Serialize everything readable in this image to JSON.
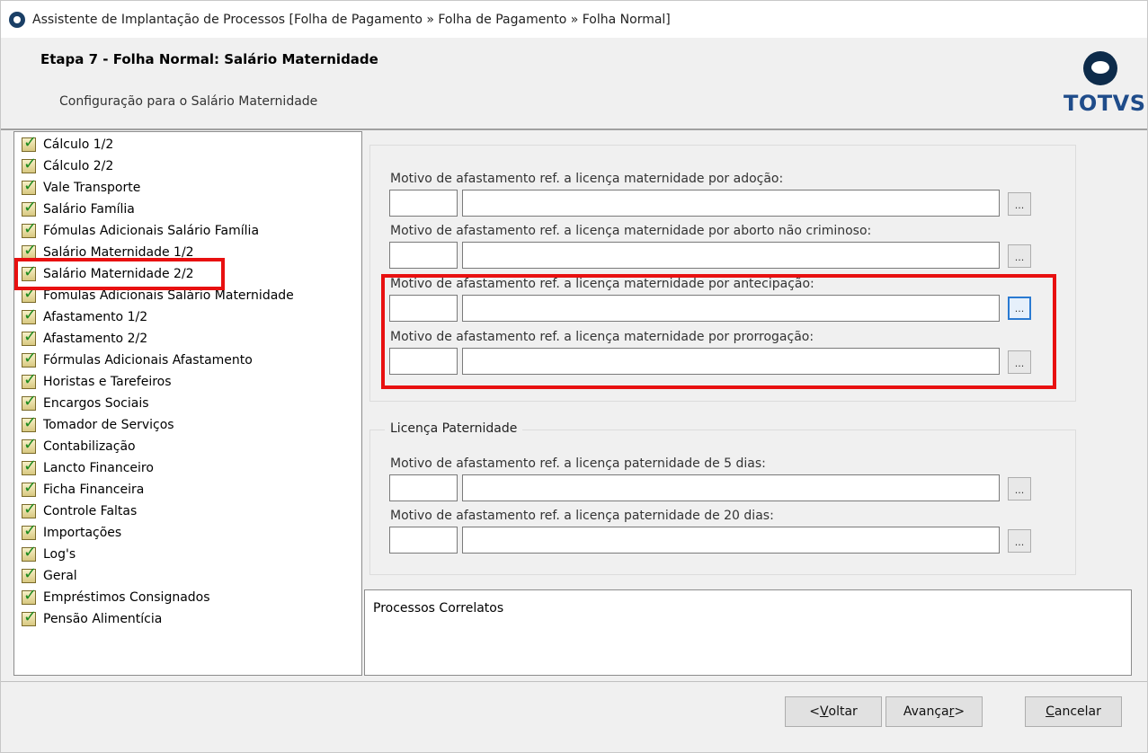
{
  "window": {
    "title": "Assistente de Implantação de Processos [Folha de Pagamento » Folha de Pagamento » Folha Normal]"
  },
  "header": {
    "step_title": "Etapa 7 - Folha Normal: Salário Maternidade",
    "step_subtitle": "Configuração para o Salário Maternidade",
    "logo_text": "TOTVS"
  },
  "tree": {
    "items": [
      {
        "label": "Cálculo 1/2"
      },
      {
        "label": "Cálculo 2/2"
      },
      {
        "label": "Vale Transporte"
      },
      {
        "label": "Salário Família"
      },
      {
        "label": "Fómulas Adicionais Salário Família"
      },
      {
        "label": "Salário Maternidade 1/2"
      },
      {
        "label": "Salário Maternidade 2/2"
      },
      {
        "label": "Fomulas Adicionais Salário Maternidade"
      },
      {
        "label": "Afastamento 1/2"
      },
      {
        "label": "Afastamento 2/2"
      },
      {
        "label": "Fórmulas Adicionais Afastamento"
      },
      {
        "label": "Horistas e Tarefeiros"
      },
      {
        "label": "Encargos Sociais"
      },
      {
        "label": "Tomador de Serviços"
      },
      {
        "label": "Contabilização"
      },
      {
        "label": "Lancto Financeiro"
      },
      {
        "label": "Ficha Financeira"
      },
      {
        "label": "Controle Faltas"
      },
      {
        "label": "Importações"
      },
      {
        "label": "Log's"
      },
      {
        "label": "Geral"
      },
      {
        "label": "Empréstimos Consignados"
      },
      {
        "label": "Pensão Alimentícia"
      }
    ],
    "selected": "Salário Maternidade 2/2"
  },
  "maternidade": {
    "fields": [
      {
        "label": "Motivo de afastamento ref. a licença maternidade por adoção:",
        "code": "",
        "description": "",
        "lookup": "..."
      },
      {
        "label": "Motivo de afastamento ref. a licença maternidade por aborto não criminoso:",
        "code": "",
        "description": "",
        "lookup": "..."
      },
      {
        "label": "Motivo de afastamento ref. a licença maternidade por antecipação:",
        "code": "",
        "description": "",
        "lookup": "..."
      },
      {
        "label": "Motivo de afastamento ref. a licença maternidade por prorrogação:",
        "code": "",
        "description": "",
        "lookup": "..."
      }
    ]
  },
  "paternidade": {
    "group_title": "Licença Paternidade",
    "fields": [
      {
        "label": "Motivo de afastamento ref. a licença  paternidade  de 5 dias:",
        "code": "",
        "description": "",
        "lookup": "..."
      },
      {
        "label": "Motivo de afastamento ref. a licença  paternidade  de 20 dias:",
        "code": "",
        "description": "",
        "lookup": "..."
      }
    ]
  },
  "correlatos": {
    "label": "Processos Correlatos"
  },
  "footer": {
    "back_prefix": "< ",
    "back_accel": "V",
    "back_rest": "oltar",
    "next_prefix": "Avança",
    "next_accel": "r",
    "next_rest": " >",
    "cancel_accel": "C",
    "cancel_rest": "ancelar"
  },
  "colors": {
    "highlight": "#e81010",
    "logo_blue": "#1f4c8a",
    "focus_blue": "#2a7ad2"
  }
}
